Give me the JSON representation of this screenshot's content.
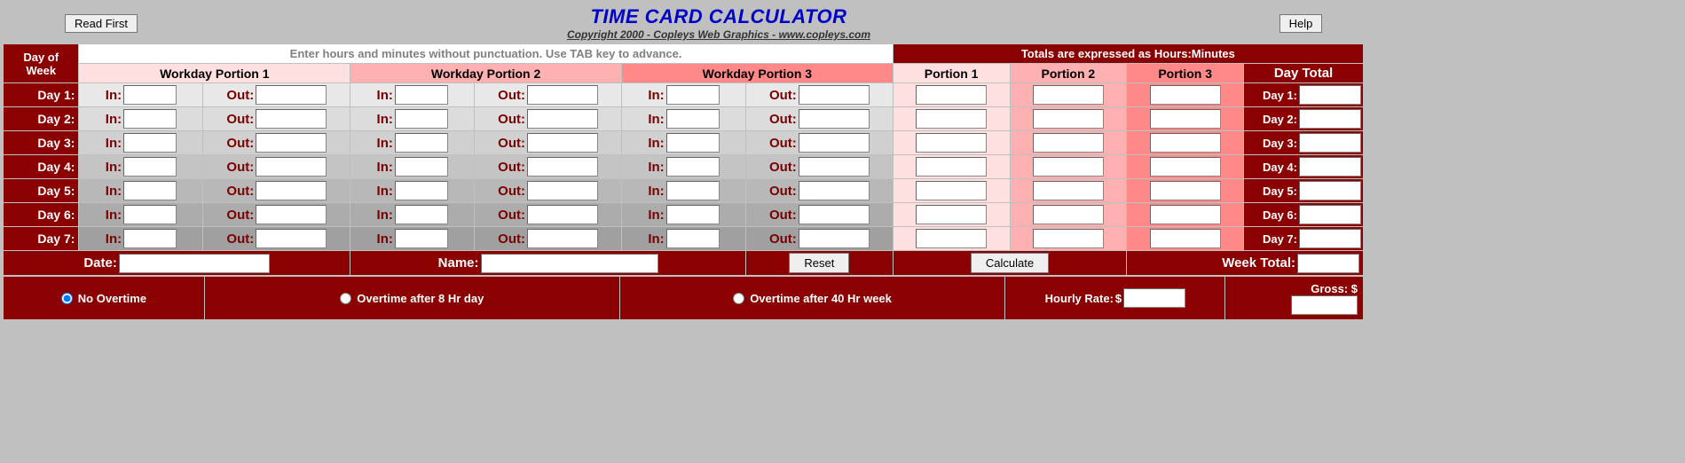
{
  "header": {
    "read_first": "Read First",
    "help": "Help",
    "title": "TIME CARD CALCULATOR",
    "subtitle": "Copyright 2000 - Copleys Web Graphics - www.copleys.com"
  },
  "labels": {
    "day_of_week": "Day of Week",
    "day_of": "Day of",
    "week": "Week",
    "hint": "Enter hours and minutes without punctuation. Use TAB key to advance.",
    "totals_hint": "Totals are expressed as Hours:Minutes",
    "wp1": "Workday Portion 1",
    "wp2": "Workday Portion 2",
    "wp3": "Workday Portion 3",
    "p1": "Portion  1",
    "p2": "Portion  2",
    "p3": "Portion  3",
    "day_total": "Day Total",
    "in": "In:",
    "out": "Out:",
    "date": "Date:",
    "name": "Name:",
    "reset": "Reset",
    "calculate": "Calculate",
    "week_total": "Week Total:",
    "no_overtime": "No Overtime",
    "ot_8": "Overtime after 8 Hr day",
    "ot_40": "Overtime after 40 Hr week",
    "hourly_rate": "Hourly Rate:",
    "gross": "Gross:",
    "dollar": "$"
  },
  "days": [
    {
      "label": "Day  1:",
      "total_label": "Day 1:",
      "in1": "",
      "out1": "",
      "in2": "",
      "out2": "",
      "in3": "",
      "out3": "",
      "p1": "",
      "p2": "",
      "p3": "",
      "total": ""
    },
    {
      "label": "Day  2:",
      "total_label": "Day 2:",
      "in1": "",
      "out1": "",
      "in2": "",
      "out2": "",
      "in3": "",
      "out3": "",
      "p1": "",
      "p2": "",
      "p3": "",
      "total": ""
    },
    {
      "label": "Day  3:",
      "total_label": "Day 3:",
      "in1": "",
      "out1": "",
      "in2": "",
      "out2": "",
      "in3": "",
      "out3": "",
      "p1": "",
      "p2": "",
      "p3": "",
      "total": ""
    },
    {
      "label": "Day  4:",
      "total_label": "Day 4:",
      "in1": "",
      "out1": "",
      "in2": "",
      "out2": "",
      "in3": "",
      "out3": "",
      "p1": "",
      "p2": "",
      "p3": "",
      "total": ""
    },
    {
      "label": "Day  5:",
      "total_label": "Day 5:",
      "in1": "",
      "out1": "",
      "in2": "",
      "out2": "",
      "in3": "",
      "out3": "",
      "p1": "",
      "p2": "",
      "p3": "",
      "total": ""
    },
    {
      "label": "Day  6:",
      "total_label": "Day 6:",
      "in1": "",
      "out1": "",
      "in2": "",
      "out2": "",
      "in3": "",
      "out3": "",
      "p1": "",
      "p2": "",
      "p3": "",
      "total": ""
    },
    {
      "label": "Day  7:",
      "total_label": "Day 7:",
      "in1": "",
      "out1": "",
      "in2": "",
      "out2": "",
      "in3": "",
      "out3": "",
      "p1": "",
      "p2": "",
      "p3": "",
      "total": ""
    }
  ],
  "fields": {
    "date": "",
    "name": "",
    "week_total": "",
    "hourly_rate": "",
    "gross": "",
    "overtime_selected": "none"
  },
  "colors": {
    "maroon": "#8b0000",
    "wp1": "#ffe0e0",
    "wp2": "#ffb0b0",
    "wp3": "#ff8888"
  }
}
